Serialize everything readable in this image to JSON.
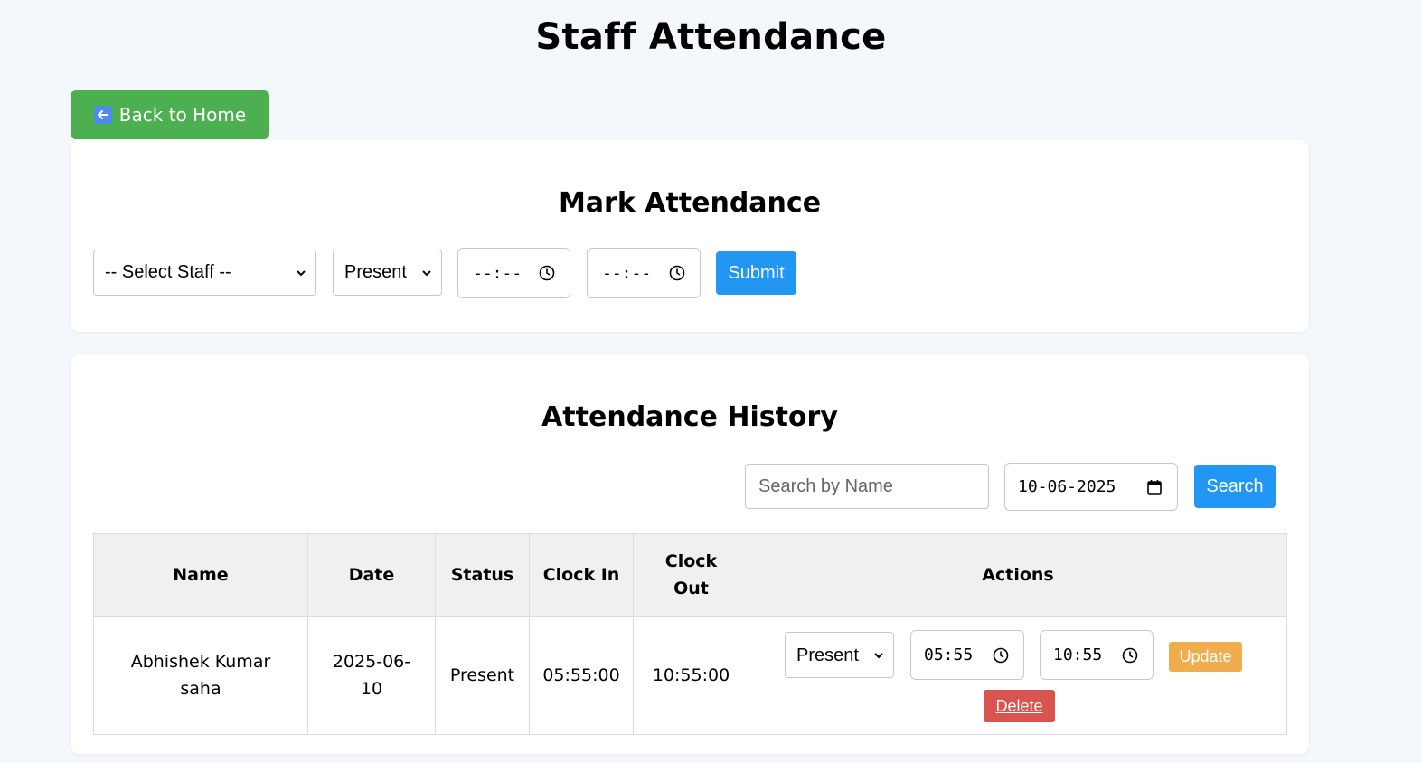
{
  "page": {
    "title": "Staff Attendance"
  },
  "back_button": {
    "label": "Back to Home",
    "icon": "arrow-left-icon"
  },
  "mark_attendance": {
    "title": "Mark Attendance",
    "staff_select": {
      "selected": "-- Select Staff --"
    },
    "status_select": {
      "selected": "Present"
    },
    "clock_in": {
      "value": "--:--"
    },
    "clock_out": {
      "value": "--:--"
    },
    "submit_label": "Submit"
  },
  "history": {
    "title": "Attendance History",
    "search": {
      "placeholder": "Search by Name",
      "value": ""
    },
    "date_filter": {
      "value": "10-06-2025"
    },
    "search_button": "Search",
    "columns": {
      "name": "Name",
      "date": "Date",
      "status": "Status",
      "clock_in": "Clock In",
      "clock_out": "Clock Out",
      "actions": "Actions"
    },
    "rows": [
      {
        "name": "Abhishek Kumar saha",
        "date": "2025-06-10",
        "status": "Present",
        "clock_in": "05:55:00",
        "clock_out": "10:55:00",
        "edit_status": "Present",
        "edit_clock_in": "05:55",
        "edit_clock_out": "10:55",
        "update_label": "Update",
        "delete_label": "Delete"
      }
    ]
  },
  "colors": {
    "background": "#f4f7fb",
    "back_button": "#4caf50",
    "primary": "#2196f3",
    "update": "#f0ad4e",
    "delete": "#d9534f",
    "table_header": "#f0f0f0"
  }
}
